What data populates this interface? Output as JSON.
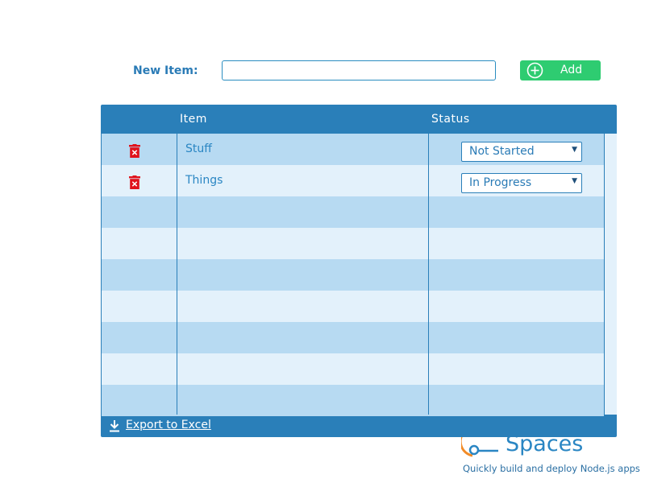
{
  "form": {
    "new_item_label": "New Item:",
    "new_item_value": "",
    "new_item_placeholder": "",
    "add_label": "Add"
  },
  "table": {
    "columns": [
      "",
      "Item",
      "Status"
    ],
    "rows": [
      {
        "item": "Stuff",
        "status": "Not Started"
      },
      {
        "item": "Things",
        "status": "In Progress"
      }
    ]
  },
  "footer": {
    "export_label": "Export to Excel"
  },
  "branding": {
    "product_name": "Spaces",
    "tagline": "Quickly build and deploy Node.js apps"
  },
  "colors": {
    "accent": "#2a7fb9",
    "add_button": "#2ecc71",
    "delete_icon": "#e0121b",
    "row_stripe": "#b7daf2",
    "row_alt": "#e3f1fb"
  }
}
